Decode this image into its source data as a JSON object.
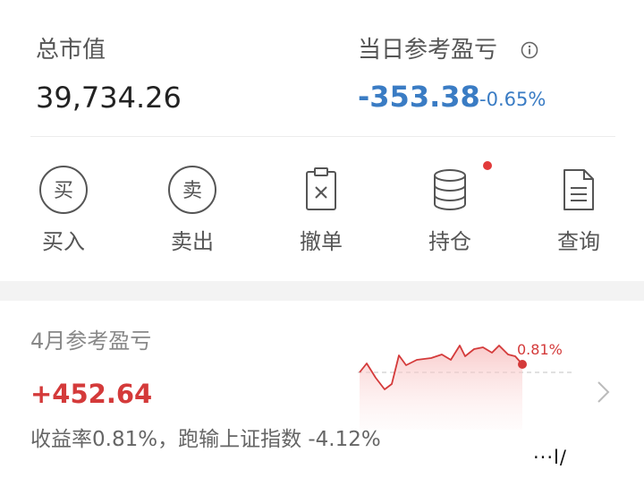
{
  "summary": {
    "total_label": "总市值",
    "total_value": "39,734.26",
    "pnl_label": "当日参考盈亏",
    "pnl_value": "-353.38",
    "pnl_pct": "-0.65%"
  },
  "actions": [
    {
      "label": "买入",
      "icon": "buy-icon",
      "glyph": "买"
    },
    {
      "label": "卖出",
      "icon": "sell-icon",
      "glyph": "卖"
    },
    {
      "label": "撤单",
      "icon": "cancel-order-icon"
    },
    {
      "label": "持仓",
      "icon": "database-icon"
    },
    {
      "label": "查询",
      "icon": "document-icon"
    }
  ],
  "month": {
    "label": "4月参考盈亏",
    "value": "+452.64",
    "desc": "收益率0.81%，跑输上证指数 -4.12%",
    "end_label": "0.81%"
  },
  "colors": {
    "up": "#d43a3a",
    "down": "#3a7cc4",
    "accent_dot": "#e23b3b"
  },
  "watermark": "···l/"
}
